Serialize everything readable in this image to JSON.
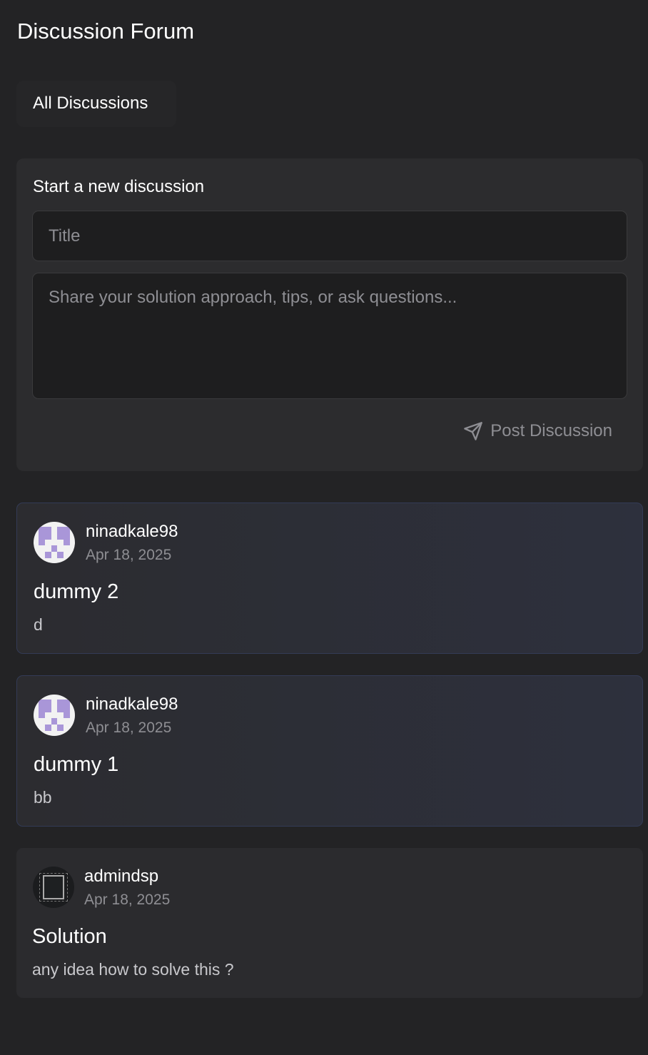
{
  "header": {
    "title": "Discussion Forum"
  },
  "tabs": [
    {
      "label": "All Discussions",
      "active": true
    }
  ],
  "new_discussion": {
    "heading": "Start a new discussion",
    "title_placeholder": "Title",
    "title_value": "",
    "body_placeholder": "Share your solution approach, tips, or ask questions...",
    "body_value": "",
    "post_label": "Post Discussion",
    "post_icon": "send-icon"
  },
  "posts": [
    {
      "user": "ninadkale98",
      "date": "Apr 18, 2025",
      "title": "dummy 2",
      "body": "d",
      "avatar": "identicon",
      "highlighted": true
    },
    {
      "user": "ninadkale98",
      "date": "Apr 18, 2025",
      "title": "dummy 1",
      "body": "bb",
      "avatar": "identicon",
      "highlighted": true
    },
    {
      "user": "admindsp",
      "date": "Apr 18, 2025",
      "title": "Solution",
      "body": "any idea how to solve this ?",
      "avatar": "default",
      "highlighted": false
    }
  ],
  "colors": {
    "background": "#232325",
    "card": "#2c2c2e",
    "identicon": "#a996d8",
    "highlight_border": "#333b56"
  }
}
